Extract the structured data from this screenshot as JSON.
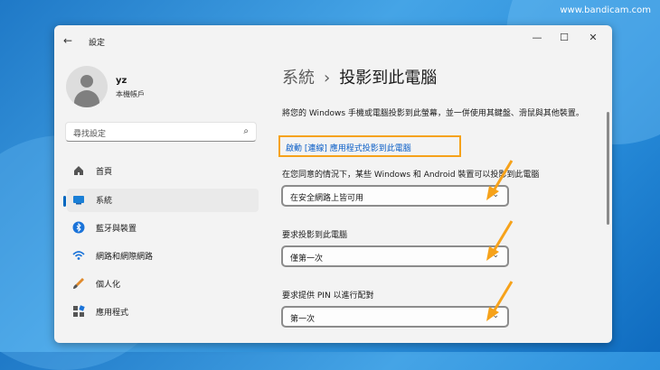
{
  "watermark": "www.bandicam.com",
  "window": {
    "title": "設定",
    "controls": [
      "—",
      "☐",
      "✕"
    ]
  },
  "user": {
    "name": "yz",
    "type": "本機帳戶"
  },
  "search": {
    "placeholder": "尋找設定"
  },
  "nav": [
    {
      "label": "首頁",
      "icon": "home-icon",
      "active": false
    },
    {
      "label": "系統",
      "icon": "monitor-icon",
      "active": true
    },
    {
      "label": "藍牙與裝置",
      "icon": "bluetooth-icon",
      "active": false
    },
    {
      "label": "網路和網際網路",
      "icon": "wifi-icon",
      "active": false
    },
    {
      "label": "個人化",
      "icon": "brush-icon",
      "active": false
    },
    {
      "label": "應用程式",
      "icon": "apps-icon",
      "active": false
    }
  ],
  "breadcrumb": {
    "parent": "系統",
    "separator": "›",
    "current": "投影到此電腦"
  },
  "description": "將您的 Windows 手機或電腦投影到此螢幕，並一併使用其鍵盤、滑鼠與其他裝置。",
  "link": "啟動 [連線] 應用程式投影到此電腦",
  "settings": [
    {
      "label": "在您同意的情況下，某些 Windows 和 Android 裝置可以投影到此電腦",
      "value": "在安全網路上皆可用"
    },
    {
      "label": "要求投影到此電腦",
      "value": "僅第一次"
    },
    {
      "label": "要求提供 PIN 以進行配對",
      "value": "第一次"
    }
  ],
  "colors": {
    "accent": "#0067c0",
    "highlight": "#f6a21a",
    "link": "#0a5ec7"
  }
}
